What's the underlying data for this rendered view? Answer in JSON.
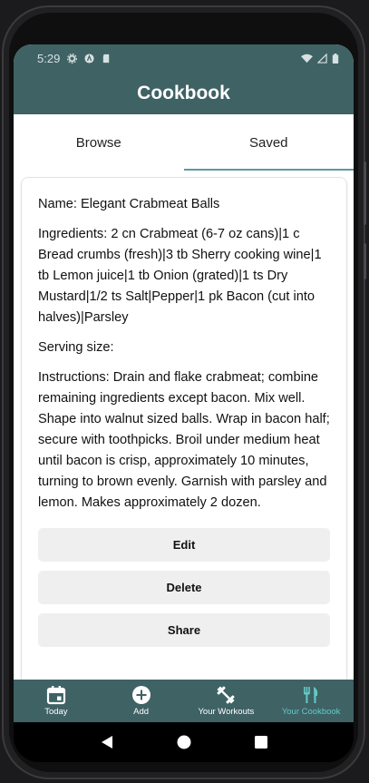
{
  "status_bar": {
    "time": "5:29"
  },
  "app_bar": {
    "title": "Cookbook"
  },
  "tabs": [
    {
      "label": "Browse",
      "active": false
    },
    {
      "label": "Saved",
      "active": true
    }
  ],
  "recipe": {
    "name": "Name: Elegant Crabmeat Balls",
    "ingredients": "Ingredients: 2 cn Crabmeat (6-7 oz cans)|1 c Bread crumbs (fresh)|3 tb Sherry cooking wine|1 tb Lemon juice|1 tb Onion (grated)|1 ts Dry Mustard|1/2 ts Salt|Pepper|1 pk Bacon (cut into halves)|Parsley",
    "serving_size": "Serving size:",
    "instructions": "Instructions: Drain and flake crabmeat; combine remaining ingredients except bacon. Mix well. Shape into walnut sized balls. Wrap in bacon half; secure with toothpicks. Broil under medium heat until bacon is crisp, approximately 10 minutes, turning to brown evenly. Garnish with parsley and lemon. Makes approximately 2 dozen."
  },
  "actions": {
    "edit": "Edit",
    "delete": "Delete",
    "share": "Share"
  },
  "bottom_nav": [
    {
      "label": "Today",
      "icon": "calendar-icon"
    },
    {
      "label": "Add",
      "icon": "add-circle-icon"
    },
    {
      "label": "Your Workouts",
      "icon": "dumbbell-icon"
    },
    {
      "label": "Your Cookbook",
      "icon": "utensils-icon",
      "active": true
    }
  ],
  "colors": {
    "primary": "#3f6265",
    "active_nav": "#63c9c4",
    "tab_indicator": "#5a9aa2"
  }
}
